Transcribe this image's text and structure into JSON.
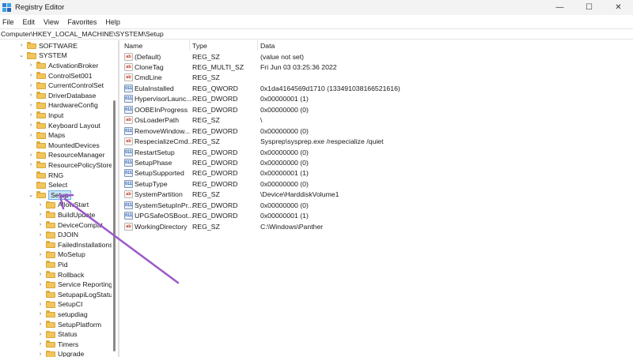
{
  "window": {
    "title": "Registry Editor",
    "controls": [
      "—",
      "☐",
      "✕"
    ]
  },
  "menu": [
    "File",
    "Edit",
    "View",
    "Favorites",
    "Help"
  ],
  "address": "Computer\\HKEY_LOCAL_MACHINE\\SYSTEM\\Setup",
  "tree": [
    {
      "label": "SOFTWARE",
      "level": 1,
      "expander": "›"
    },
    {
      "label": "SYSTEM",
      "level": 1,
      "expander": "⌄"
    },
    {
      "label": "ActivationBroker",
      "level": 2,
      "expander": "›"
    },
    {
      "label": "ControlSet001",
      "level": 2,
      "expander": "›"
    },
    {
      "label": "CurrentControlSet",
      "level": 2,
      "expander": "›"
    },
    {
      "label": "DriverDatabase",
      "level": 2,
      "expander": "›"
    },
    {
      "label": "HardwareConfig",
      "level": 2,
      "expander": "›"
    },
    {
      "label": "Input",
      "level": 2,
      "expander": "›"
    },
    {
      "label": "Keyboard Layout",
      "level": 2,
      "expander": "›"
    },
    {
      "label": "Maps",
      "level": 2,
      "expander": "›"
    },
    {
      "label": "MountedDevices",
      "level": 2,
      "expander": ""
    },
    {
      "label": "ResourceManager",
      "level": 2,
      "expander": "›"
    },
    {
      "label": "ResourcePolicyStore",
      "level": 2,
      "expander": "›"
    },
    {
      "label": "RNG",
      "level": 2,
      "expander": ""
    },
    {
      "label": "Select",
      "level": 2,
      "expander": ""
    },
    {
      "label": "Setup",
      "level": 2,
      "expander": "⌄",
      "selected": true
    },
    {
      "label": "AllowStart",
      "level": 3,
      "expander": "›"
    },
    {
      "label": "BuildUpdate",
      "level": 3,
      "expander": "›"
    },
    {
      "label": "DeviceCompat",
      "level": 3,
      "expander": "›"
    },
    {
      "label": "DJOIN",
      "level": 3,
      "expander": "›"
    },
    {
      "label": "FailedInstallations",
      "level": 3,
      "expander": ""
    },
    {
      "label": "MoSetup",
      "level": 3,
      "expander": "›"
    },
    {
      "label": "Pid",
      "level": 3,
      "expander": ""
    },
    {
      "label": "Rollback",
      "level": 3,
      "expander": "›"
    },
    {
      "label": "Service Reporting",
      "level": 3,
      "expander": "›"
    },
    {
      "label": "SetupapiLogStatu",
      "level": 3,
      "expander": ""
    },
    {
      "label": "SetupCI",
      "level": 3,
      "expander": "›"
    },
    {
      "label": "setupdiag",
      "level": 3,
      "expander": "›"
    },
    {
      "label": "SetupPlatform",
      "level": 3,
      "expander": "›"
    },
    {
      "label": "Status",
      "level": 3,
      "expander": "›"
    },
    {
      "label": "Timers",
      "level": 3,
      "expander": "›"
    },
    {
      "label": "Upgrade",
      "level": 3,
      "expander": "›"
    }
  ],
  "columns": [
    "Name",
    "Type",
    "Data"
  ],
  "values": [
    {
      "name": "(Default)",
      "type": "REG_SZ",
      "data": "(value not set)",
      "icon": "sz"
    },
    {
      "name": "CloneTag",
      "type": "REG_MULTI_SZ",
      "data": "Fri Jun 03 03:25:36 2022",
      "icon": "sz"
    },
    {
      "name": "CmdLine",
      "type": "REG_SZ",
      "data": "",
      "icon": "sz"
    },
    {
      "name": "EulaInstalled",
      "type": "REG_QWORD",
      "data": "0x1da4164569d1710 (133491038166521616)",
      "icon": "bin"
    },
    {
      "name": "HypervisorLaunc...",
      "type": "REG_DWORD",
      "data": "0x00000001 (1)",
      "icon": "bin"
    },
    {
      "name": "OOBEInProgress",
      "type": "REG_DWORD",
      "data": "0x00000000 (0)",
      "icon": "bin"
    },
    {
      "name": "OsLoaderPath",
      "type": "REG_SZ",
      "data": "\\",
      "icon": "sz"
    },
    {
      "name": "RemoveWindow...",
      "type": "REG_DWORD",
      "data": "0x00000000 (0)",
      "icon": "bin"
    },
    {
      "name": "RespecializeCmd...",
      "type": "REG_SZ",
      "data": "Sysprep\\sysprep.exe /respecialize /quiet",
      "icon": "sz"
    },
    {
      "name": "RestartSetup",
      "type": "REG_DWORD",
      "data": "0x00000000 (0)",
      "icon": "bin"
    },
    {
      "name": "SetupPhase",
      "type": "REG_DWORD",
      "data": "0x00000000 (0)",
      "icon": "bin"
    },
    {
      "name": "SetupSupported",
      "type": "REG_DWORD",
      "data": "0x00000001 (1)",
      "icon": "bin"
    },
    {
      "name": "SetupType",
      "type": "REG_DWORD",
      "data": "0x00000000 (0)",
      "icon": "bin"
    },
    {
      "name": "SystemPartition",
      "type": "REG_SZ",
      "data": "\\Device\\HarddiskVolume1",
      "icon": "sz"
    },
    {
      "name": "SystemSetupInPr...",
      "type": "REG_DWORD",
      "data": "0x00000000 (0)",
      "icon": "bin"
    },
    {
      "name": "UPGSafeOSBoot...",
      "type": "REG_DWORD",
      "data": "0x00000001 (1)",
      "icon": "bin"
    },
    {
      "name": "WorkingDirectory",
      "type": "REG_SZ",
      "data": "C:\\Windows\\Panther",
      "icon": "sz"
    }
  ],
  "icons": {
    "sz": "ab",
    "bin": "011"
  },
  "colors": {
    "arrow": "#9b59c9",
    "selection_bg": "#cce4f7",
    "folder": "#f2c55c"
  }
}
